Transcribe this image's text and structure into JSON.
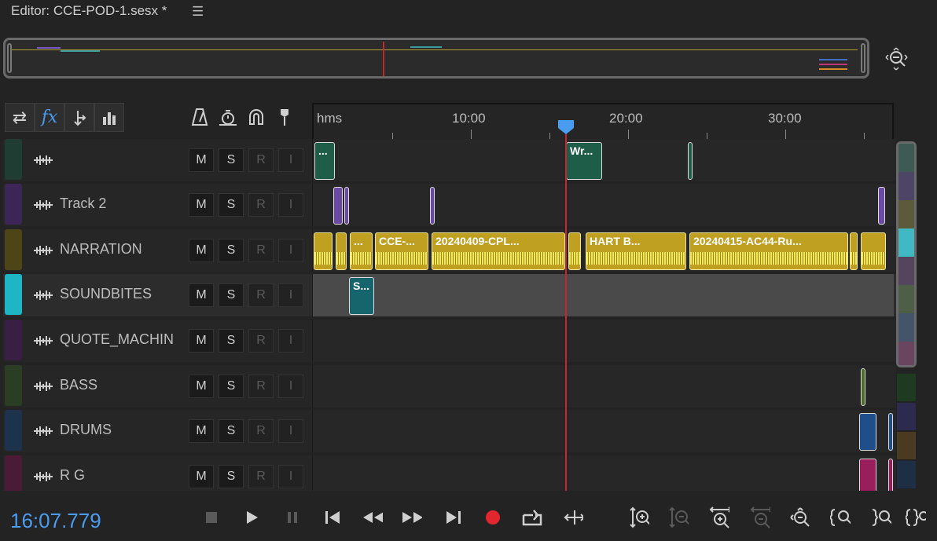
{
  "header": {
    "title": "Editor: CCE-POD-1.sesx *",
    "menu_icon": "hamburger-menu-icon"
  },
  "ruler": {
    "labels": [
      "hms",
      "10:00",
      "20:00",
      "30:00"
    ]
  },
  "time_display": "16:07.779",
  "tracks": [
    {
      "name": "",
      "color": "#1f3d33",
      "buttons": [
        "M",
        "S",
        "R",
        "I"
      ]
    },
    {
      "name": "Track 2",
      "color": "#3c2657",
      "buttons": [
        "M",
        "S",
        "R",
        "I"
      ]
    },
    {
      "name": "NARRATION",
      "color": "#4d4418",
      "buttons": [
        "M",
        "S",
        "R",
        "I"
      ]
    },
    {
      "name": "SOUNDBITES",
      "color": "#1eb6c4",
      "buttons": [
        "M",
        "S",
        "R",
        "I"
      ]
    },
    {
      "name": "QUOTE_MACHIN",
      "color": "#3a1f44",
      "buttons": [
        "M",
        "S",
        "R",
        "I"
      ]
    },
    {
      "name": "BASS",
      "color": "#2b3d22",
      "buttons": [
        "M",
        "S",
        "R",
        "I"
      ]
    },
    {
      "name": "DRUMS",
      "color": "#1c324d",
      "buttons": [
        "M",
        "S",
        "R",
        "I"
      ]
    },
    {
      "name": "R G",
      "color": "#4a1a36",
      "buttons": [
        "M",
        "S",
        "R",
        "I"
      ]
    }
  ],
  "clips": {
    "t1_a": "...",
    "t1_b": "Wr...",
    "narr_1": "...",
    "narr_2": "CCE-...",
    "narr_3": "20240409-CPL...",
    "narr_4": "HART B...",
    "narr_5": "20240415-AC44-Ru...",
    "sb_1": "S..."
  },
  "colors": {
    "accent": "#4a9cf0",
    "playhead": "#c1272d",
    "narration": "#c0a020"
  }
}
